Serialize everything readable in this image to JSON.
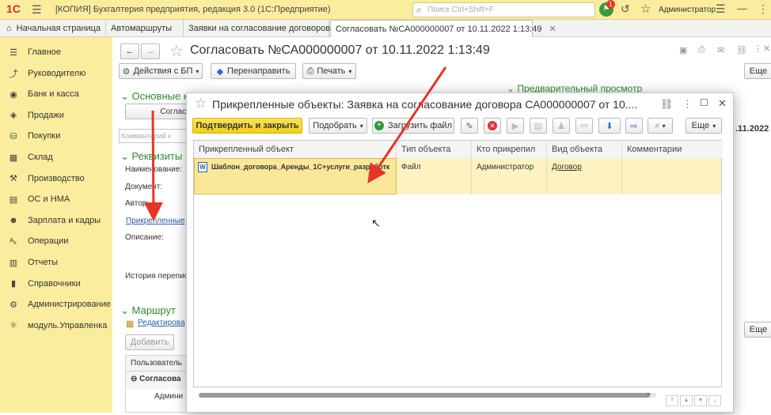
{
  "titlebar": {
    "logo": "1С",
    "title": "[КОПИЯ] Бухгалтерия предприятия, редакция 3.0  (1С:Предприятие)",
    "search_placeholder": "Поиск Ctrl+Shift+F",
    "notif_count": "1",
    "user": "Администратор"
  },
  "tabs": [
    {
      "label": "Начальная страница"
    },
    {
      "label": "Автомаршруты"
    },
    {
      "label": "Заявки на согласование договоров"
    },
    {
      "label": "Согласовать №СА000000007 от 10.11.2022 1:13:49"
    }
  ],
  "sidebar": {
    "items": [
      {
        "label": "Главное",
        "icon": "menu-icon"
      },
      {
        "label": "Руководителю",
        "icon": "chart-icon"
      },
      {
        "label": "Банк и касса",
        "icon": "bank-icon"
      },
      {
        "label": "Продажи",
        "icon": "sales-icon"
      },
      {
        "label": "Покупки",
        "icon": "cart-icon"
      },
      {
        "label": "Склад",
        "icon": "warehouse-icon"
      },
      {
        "label": "Производство",
        "icon": "factory-icon"
      },
      {
        "label": "ОС и НМА",
        "icon": "assets-icon"
      },
      {
        "label": "Зарплата и кадры",
        "icon": "people-icon"
      },
      {
        "label": "Операции",
        "icon": "operations-icon"
      },
      {
        "label": "Отчеты",
        "icon": "reports-icon"
      },
      {
        "label": "Справочники",
        "icon": "books-icon"
      },
      {
        "label": "Администрирование",
        "icon": "gear-icon"
      },
      {
        "label": "модуль.Управленка",
        "icon": "module-icon"
      }
    ]
  },
  "form": {
    "title": "Согласовать №СА000000007 от 10.11.2022 1:13:49",
    "actions_bp": "Действия с БП",
    "redirect": "Перенаправить",
    "print": "Печать",
    "more": "Еще",
    "section_main": "Основные к",
    "approve_partial": "Соглас",
    "comment_placeholder": "Комментарий к",
    "section_props": "Реквизиты",
    "label_name": "Наименование:",
    "label_doc": "Документ:",
    "label_author": "Автор:",
    "link_attached": "Прикрепленные",
    "label_desc": "Описание:",
    "label_history": "История перепис",
    "section_route": "Маршрут",
    "link_edit": "Редактирова",
    "btn_add": "Добавить",
    "route_header": "Пользователь",
    "route_group": "Согласова",
    "route_user": "Админи",
    "preview_label": "Предварительный просмотр",
    "date_partial": ".11.2022",
    "more2": "Еще"
  },
  "modal": {
    "title": "Прикрепленные объекты: Заявка на согласование договора СА000000007 от 10....",
    "confirm_button": "Подтвердить и закрыть",
    "pick_button": "Подобрать",
    "upload_button": "Загрузить файл",
    "more_button": "Еще",
    "columns": [
      "Прикрепленный объект",
      "Тип объекта",
      "Кто прикрепил",
      "Вид объекта",
      "Комментарии"
    ],
    "rows": [
      {
        "object": "Шаблон_договора_Аренды_1С+услуги_разработк",
        "type": "Файл",
        "who": "Администратор",
        "kind": "Договор",
        "comment": ""
      }
    ]
  },
  "colors": {
    "accent_yellow": "#fbed9e",
    "selected_row": "#fdf2c0",
    "arrow_red": "#e53527",
    "primary_button": "#f7d51d"
  }
}
